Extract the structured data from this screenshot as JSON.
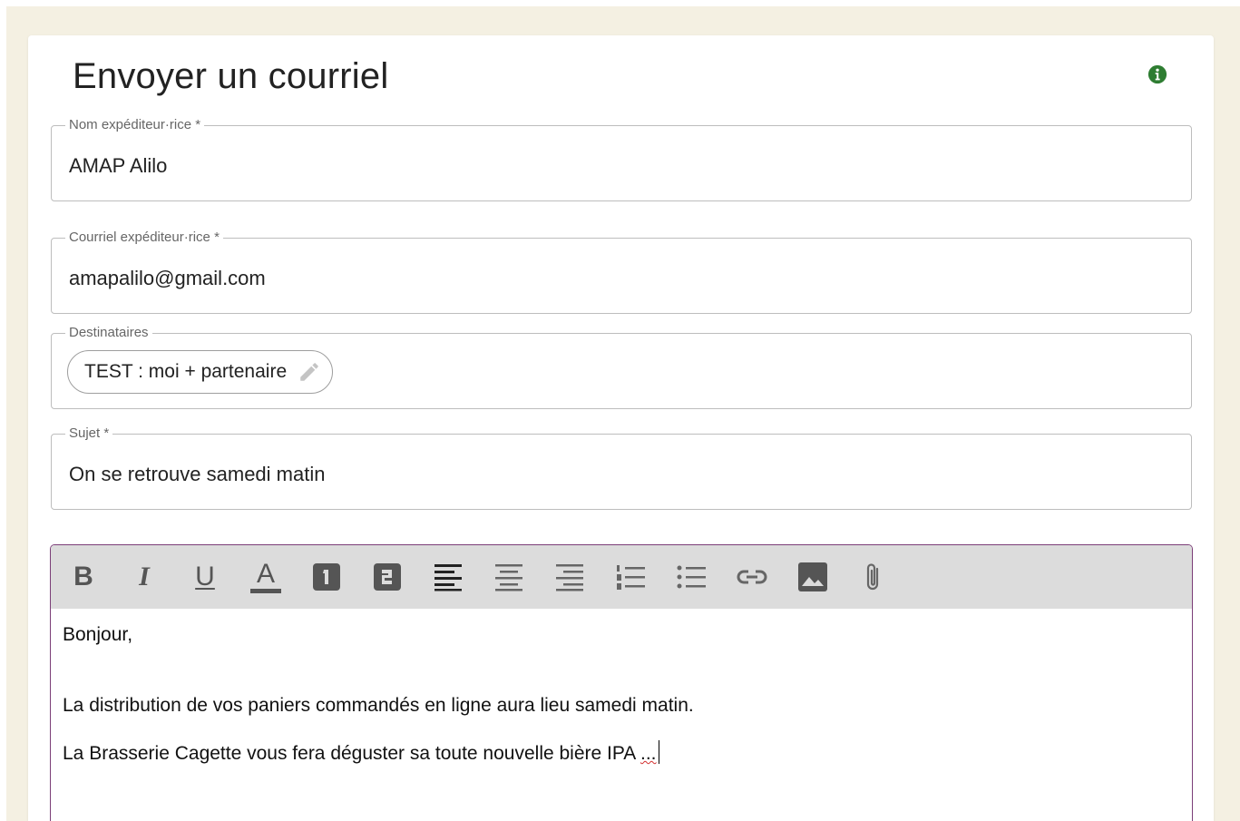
{
  "title": "Envoyer un courriel",
  "fields": {
    "sender_name": {
      "label": "Nom expéditeur·rice *",
      "value": "AMAP Alilo"
    },
    "sender_email": {
      "label": "Courriel expéditeur·rice *",
      "value": "amapalilo@gmail.com"
    },
    "recipients": {
      "label": "Destinataires",
      "chip": "TEST : moi + partenaire"
    },
    "subject": {
      "label": "Sujet *",
      "value": "On se retrouve samedi matin"
    }
  },
  "toolbar": {
    "icons": [
      "bold-icon",
      "italic-icon",
      "underline-icon",
      "text-color-icon",
      "heading-1-icon",
      "heading-2-icon",
      "align-left-icon",
      "align-center-icon",
      "align-right-icon",
      "ordered-list-icon",
      "bullet-list-icon",
      "link-icon",
      "image-icon",
      "attachment-icon"
    ],
    "bold": "B",
    "italic": "I",
    "underline": "U",
    "color": "A"
  },
  "body": {
    "line1": "Bonjour,",
    "line2": "La distribution de vos paniers commandés en ligne aura lieu samedi matin.",
    "line3": "La Brasserie Cagette vous fera déguster sa toute nouvelle bière IPA",
    "line3_tail": "..."
  },
  "colors": {
    "background": "#f4f0e2",
    "editor_border": "#7b3e78",
    "info_icon": "#2e7d32",
    "toolbar": "#dcdcdc"
  }
}
